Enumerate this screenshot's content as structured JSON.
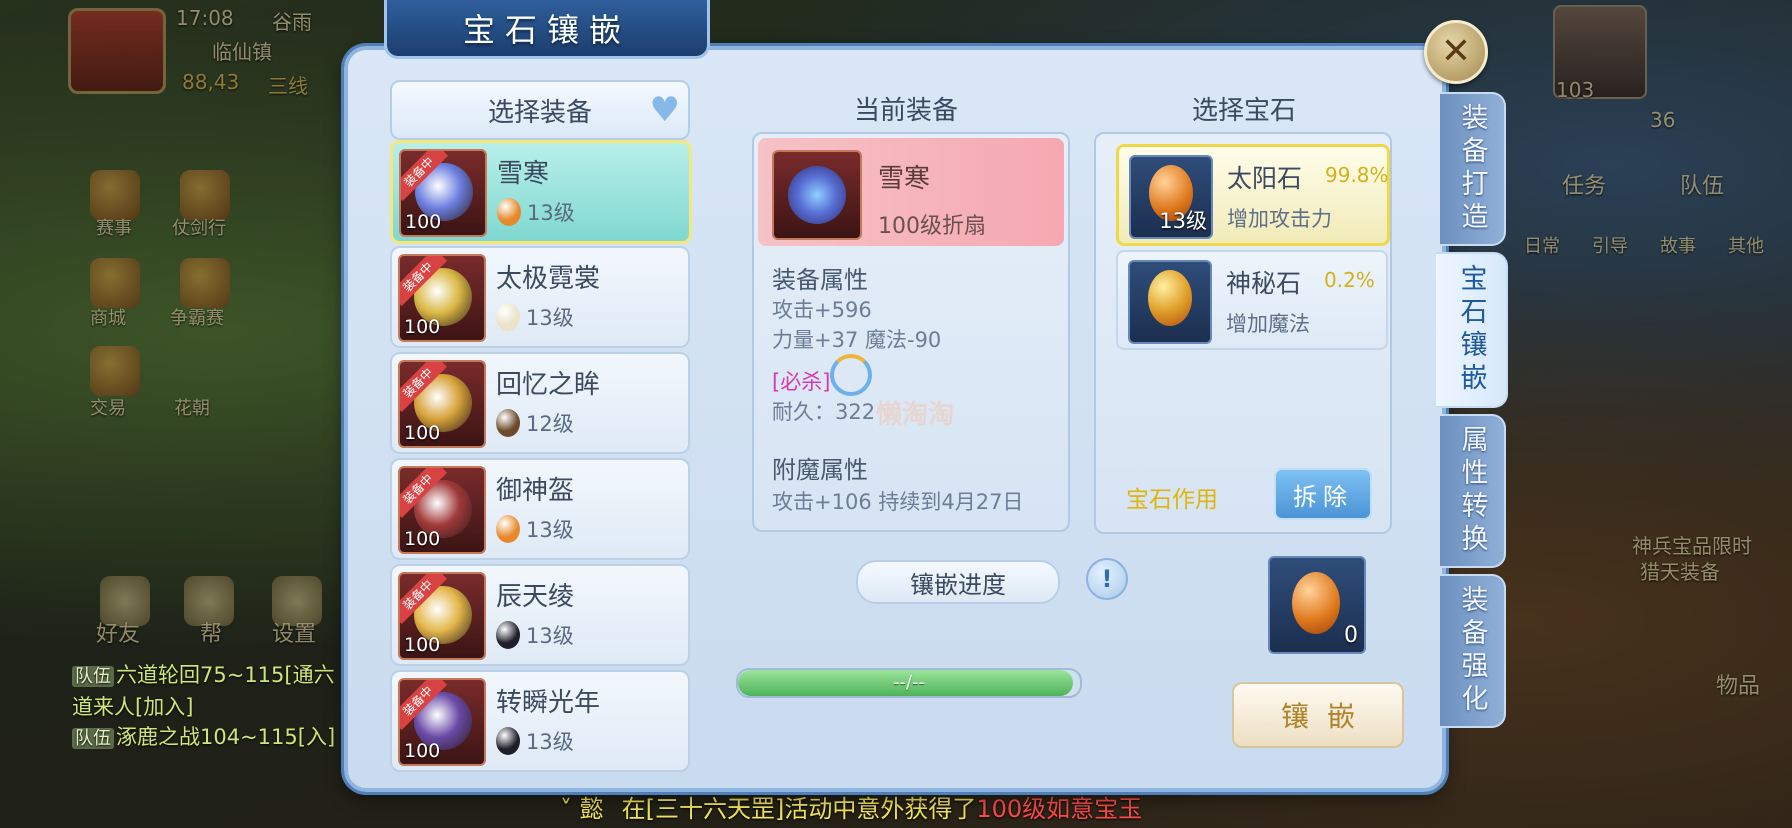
{
  "hud": {
    "time": "17:08",
    "weather": "谷雨",
    "location": "临仙镇",
    "coords": "88,43",
    "line": "三线",
    "level": "103",
    "power": "36",
    "left_icons": [
      "赛事",
      "仗剑行",
      "商城",
      "争霸赛",
      "交易",
      "花朝",
      "好友",
      "帮",
      "设置"
    ],
    "right_quest_tab": "任务",
    "right_team_tab": "队伍",
    "right_subtabs": [
      "日常",
      "引导",
      "故事",
      "其他"
    ],
    "right_notice": "神兵宝品限时",
    "right_notice2": "猎天装备",
    "right_item": "物品"
  },
  "chat": [
    {
      "tag": "队伍",
      "text": "六道轮回75~115[通六道来人[加入]"
    },
    {
      "tag": "队伍",
      "text": "涿鹿之战104~115[入]"
    }
  ],
  "ticker": {
    "prefix": "˅ 懿",
    "a": "在",
    "b": "[三十六天罡]",
    "c": "活动中意外获得了",
    "d": "100级如意宝玉"
  },
  "panel": {
    "title": "宝石镶嵌",
    "close_icon": "✕"
  },
  "side_tabs": [
    {
      "label": "装备打造",
      "active": false
    },
    {
      "label": "宝石镶嵌",
      "active": true
    },
    {
      "label": "属性转换",
      "active": false
    },
    {
      "label": "装备强化",
      "active": false
    }
  ],
  "equip_list": {
    "header": "选择装备",
    "equipped_badge": "装备中",
    "items": [
      {
        "name": "雪寒",
        "level": "100",
        "gem_level": "13级",
        "gem_color": "#e7892a",
        "art_color": "#6c7fe0",
        "selected": true
      },
      {
        "name": "太极霓裳",
        "level": "100",
        "gem_level": "13级",
        "gem_color": "#e9e3c8",
        "art_color": "#d9b845",
        "selected": false
      },
      {
        "name": "回忆之眸",
        "level": "100",
        "gem_level": "12级",
        "gem_color": "#6b4a2a",
        "art_color": "#d7a23a",
        "selected": false
      },
      {
        "name": "御神盔",
        "level": "100",
        "gem_level": "13级",
        "gem_color": "#e7892a",
        "art_color": "#a23a3a",
        "selected": false
      },
      {
        "name": "辰天绫",
        "level": "100",
        "gem_level": "13级",
        "gem_color": "#1f1f2a",
        "art_color": "#e3b64a",
        "selected": false
      },
      {
        "name": "转瞬光年",
        "level": "100",
        "gem_level": "13级",
        "gem_color": "#1f1f2a",
        "art_color": "#6a4aa8",
        "selected": false
      }
    ]
  },
  "current": {
    "title": "当前装备",
    "name": "雪寒",
    "type": "100级折扇",
    "attr_title": "装备属性",
    "attr_lines": [
      "攻击+596",
      "力量+37 魔法-90"
    ],
    "special": "[必杀]",
    "durability": "耐久：322",
    "enchant_title": "附魔属性",
    "enchant_line": "攻击+106 持续到4月27日",
    "watermark": "懒淘淘"
  },
  "gems": {
    "title": "选择宝石",
    "items": [
      {
        "name": "太阳石",
        "rate": "99.8%",
        "desc": "增加攻击力",
        "level": "13级",
        "selected": true
      },
      {
        "name": "神秘石",
        "rate": "0.2%",
        "desc": "增加魔法",
        "level": "",
        "selected": false
      }
    ],
    "effect_link": "宝石作用",
    "remove_label": "拆除"
  },
  "progress": {
    "label": "镶嵌进度",
    "help_icon": "!",
    "text": "--/--",
    "fraction": 0.0
  },
  "slot": {
    "count": "0"
  },
  "inlay_label": "镶嵌"
}
